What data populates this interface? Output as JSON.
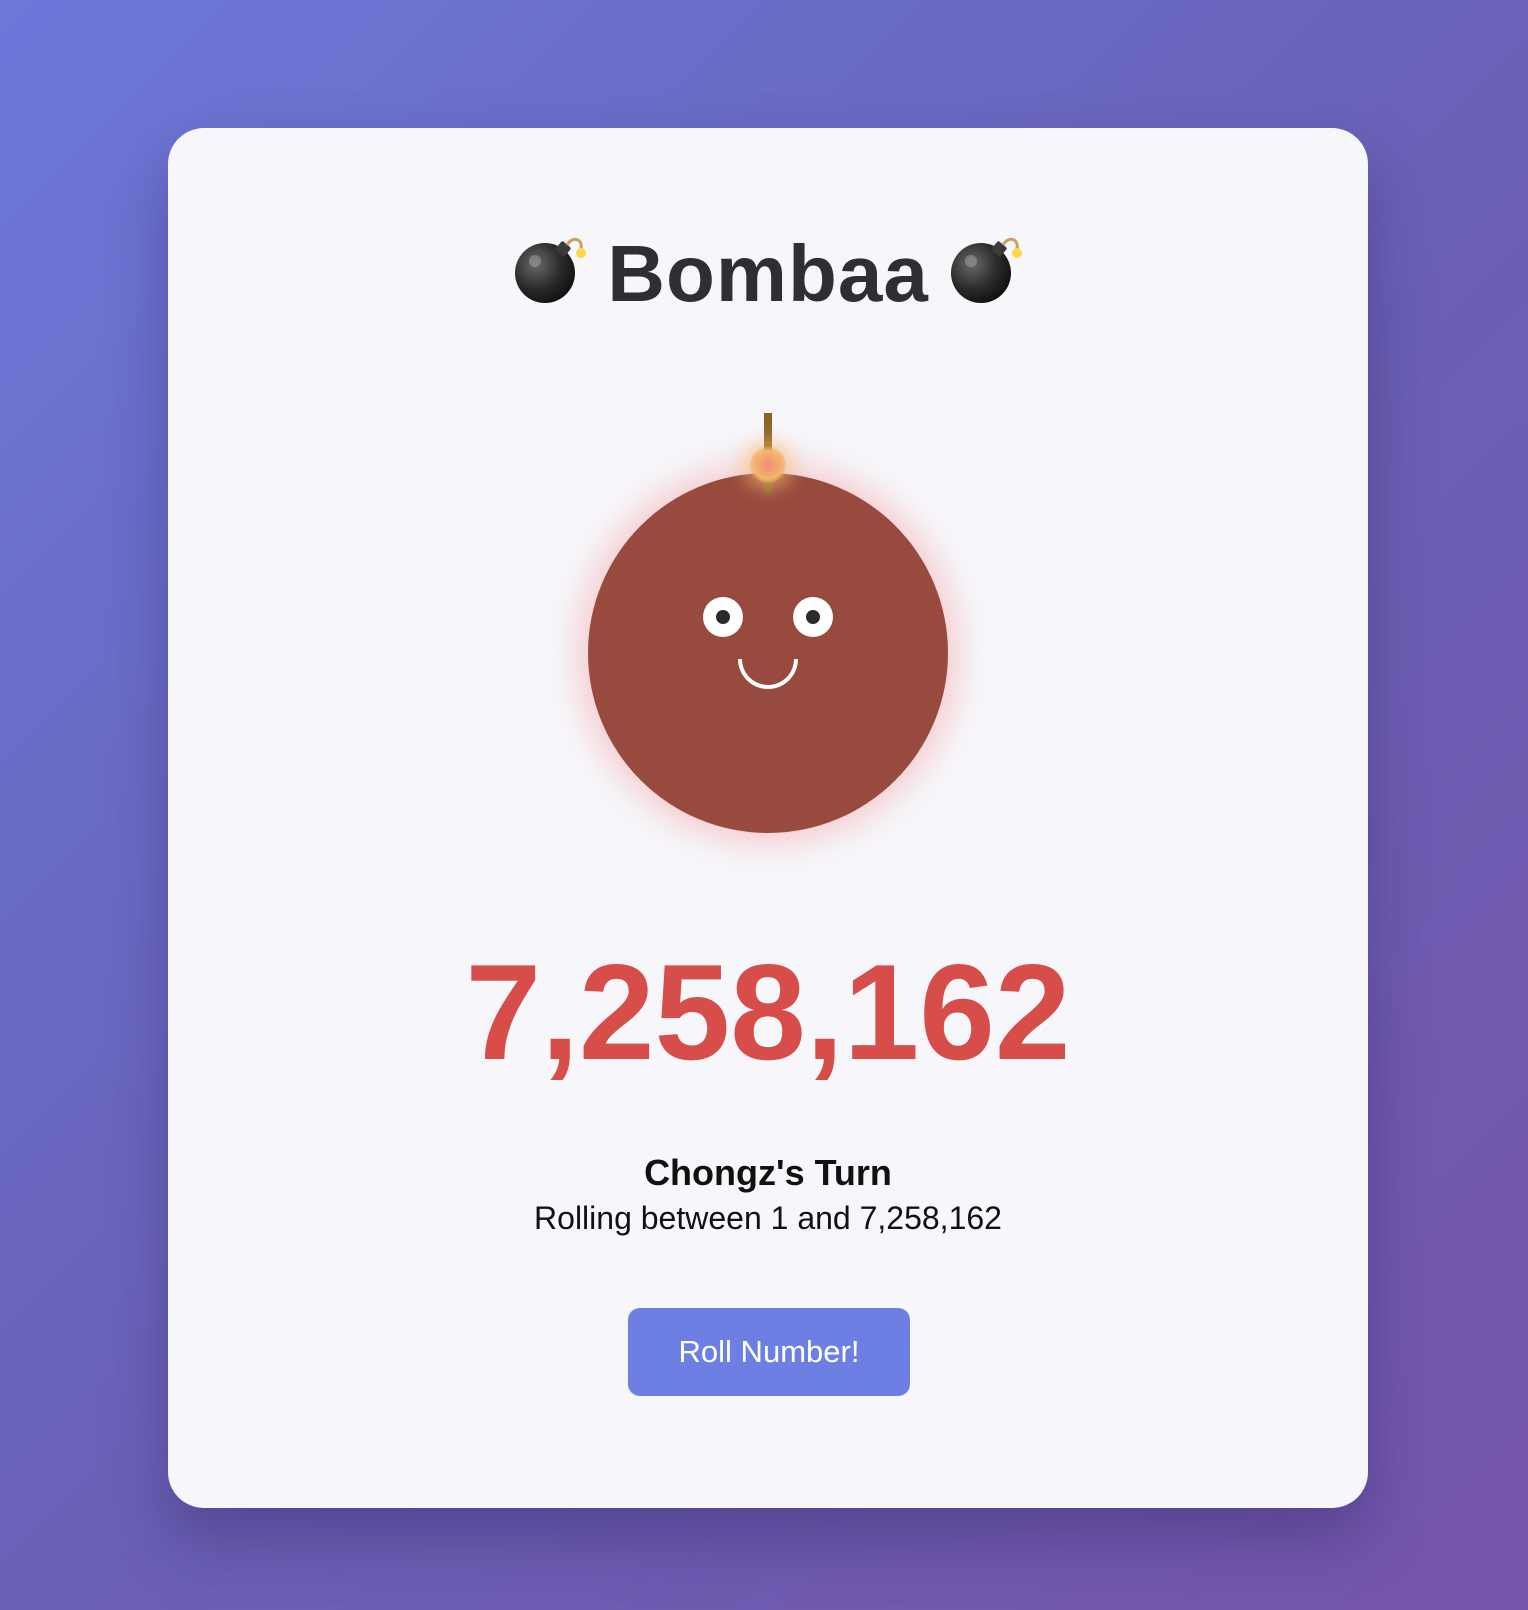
{
  "app": {
    "title": "Bombaa",
    "title_icon": "bomb-icon"
  },
  "bomb": {
    "body_color": "#994a3e",
    "fuse_color": "#8a6528",
    "expression": "smiling"
  },
  "game": {
    "current_number": "7,258,162",
    "number_color": "#d64d49",
    "turn_label": "Chongz's Turn",
    "range_text": "Rolling between 1 and 7,258,162"
  },
  "actions": {
    "roll_label": "Roll Number!",
    "roll_color": "#6d7fe3"
  }
}
